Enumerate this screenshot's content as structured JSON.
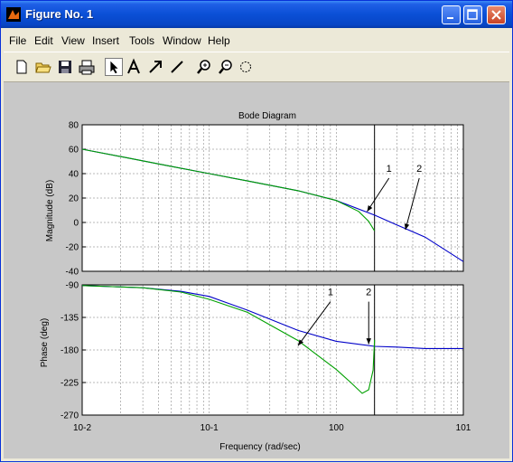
{
  "window": {
    "title": "Figure No. 1",
    "menu": [
      "File",
      "Edit",
      "View",
      "Insert",
      "Tools",
      "Window",
      "Help"
    ],
    "toolbar_icons": [
      "new-file-icon",
      "open-folder-icon",
      "save-icon",
      "print-icon",
      "pointer-arrow-icon",
      "text-A-icon",
      "arrow-tool-icon",
      "line-tool-icon",
      "zoom-in-icon",
      "zoom-out-icon",
      "rotate-icon"
    ]
  },
  "colors": {
    "series_1": "#00a000",
    "series_2": "#0000c8",
    "marker_line": "#000000"
  },
  "chart_data": [
    {
      "type": "line",
      "title": "Bode Diagram",
      "ylabel": "Magnitude (dB)",
      "xlabel": "",
      "x_scale": "log",
      "xlim": [
        0.01,
        10
      ],
      "ylim": [
        -40,
        80
      ],
      "yticks": [
        "80",
        "60",
        "40",
        "20",
        "0",
        "-20",
        "-40"
      ],
      "grid": true,
      "vertical_line_x": 2,
      "series": [
        {
          "name": "1",
          "points": [
            [
              0.01,
              60
            ],
            [
              0.02,
              54
            ],
            [
              0.05,
              46
            ],
            [
              0.1,
              40
            ],
            [
              0.2,
              34
            ],
            [
              0.5,
              26
            ],
            [
              1,
              18
            ],
            [
              1.5,
              9
            ],
            [
              1.8,
              1
            ],
            [
              2,
              -7
            ]
          ]
        },
        {
          "name": "2",
          "points": [
            [
              0.01,
              60
            ],
            [
              0.02,
              54
            ],
            [
              0.05,
              46
            ],
            [
              0.1,
              40
            ],
            [
              0.2,
              34
            ],
            [
              0.5,
              26
            ],
            [
              1,
              18
            ],
            [
              2,
              6
            ],
            [
              3,
              -2
            ],
            [
              5,
              -12
            ],
            [
              10,
              -32
            ]
          ]
        }
      ],
      "annotations": [
        {
          "text": "1",
          "text_at": [
            2.6,
            40
          ],
          "arrow_to": [
            1.75,
            9
          ]
        },
        {
          "text": "2",
          "text_at": [
            4.5,
            40
          ],
          "arrow_to": [
            3.5,
            -6
          ]
        }
      ]
    },
    {
      "type": "line",
      "ylabel": "Phase (deg)",
      "xlabel": "Frequency  (rad/sec)",
      "x_scale": "log",
      "xlim": [
        0.01,
        10
      ],
      "ylim": [
        -270,
        -90
      ],
      "yticks": [
        "-90",
        "-135",
        "-180",
        "-225",
        "-270"
      ],
      "xticks": [
        "10-2",
        "10-1",
        "100",
        "101"
      ],
      "grid": true,
      "vertical_line_x": 2,
      "series": [
        {
          "name": "1",
          "points": [
            [
              0.01,
              -91
            ],
            [
              0.03,
              -94
            ],
            [
              0.06,
              -100
            ],
            [
              0.1,
              -110
            ],
            [
              0.2,
              -128
            ],
            [
              0.5,
              -167
            ],
            [
              1,
              -207
            ],
            [
              1.3,
              -225
            ],
            [
              1.6,
              -240
            ],
            [
              1.8,
              -235
            ],
            [
              1.95,
              -208
            ],
            [
              2,
              -166
            ]
          ]
        },
        {
          "name": "2",
          "points": [
            [
              0.01,
              -91
            ],
            [
              0.03,
              -94
            ],
            [
              0.06,
              -99
            ],
            [
              0.1,
              -106
            ],
            [
              0.2,
              -125
            ],
            [
              0.5,
              -153
            ],
            [
              1,
              -168
            ],
            [
              2,
              -175
            ],
            [
              3,
              -176
            ],
            [
              5,
              -178
            ],
            [
              10,
              -178
            ]
          ]
        }
      ],
      "annotations": [
        {
          "text": "1",
          "text_at": [
            0.9,
            -107
          ],
          "arrow_to": [
            0.5,
            -174
          ]
        },
        {
          "text": "2",
          "text_at": [
            1.8,
            -107
          ],
          "arrow_to": [
            1.8,
            -172
          ]
        }
      ]
    }
  ]
}
